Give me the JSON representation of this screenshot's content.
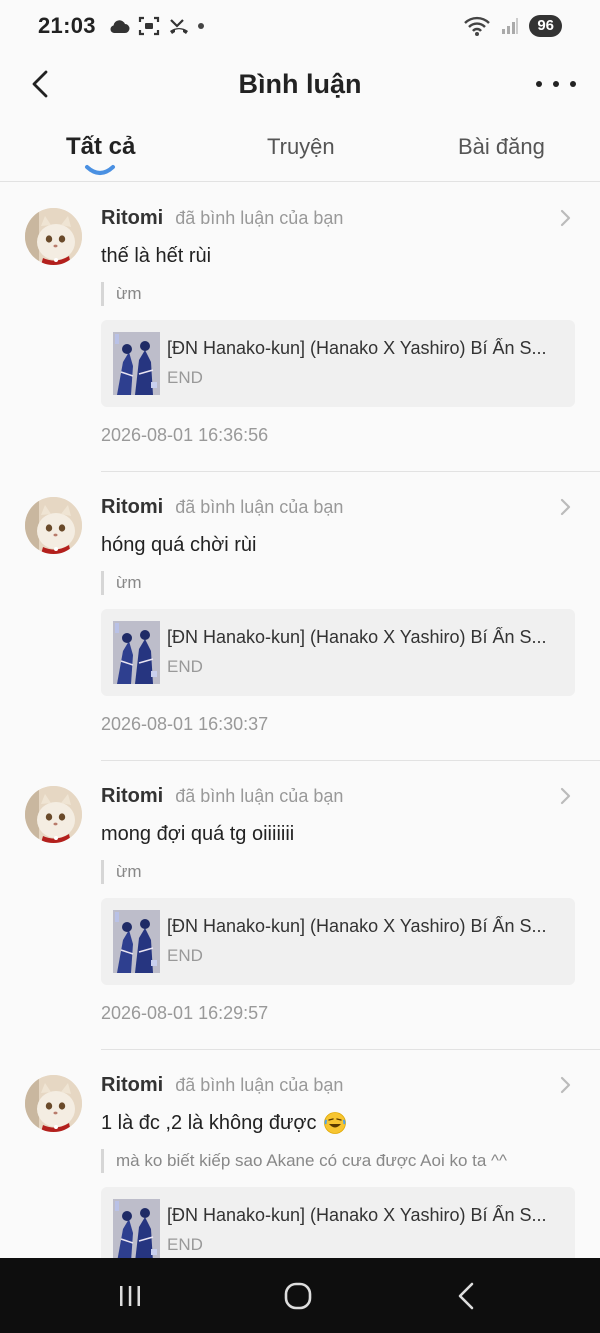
{
  "status_bar": {
    "time": "21:03",
    "battery": "96"
  },
  "header": {
    "title": "Bình luận"
  },
  "tabs": [
    {
      "label": "Tất cả",
      "active": true
    },
    {
      "label": "Truyện",
      "active": false
    },
    {
      "label": "Bài đăng",
      "active": false
    }
  ],
  "comments": [
    {
      "user": "Ritomi",
      "action": "đã bình luận của bạn",
      "text": "thế là hết rùi",
      "quote": "ừm",
      "story_title": "[ĐN Hanako-kun] (Hanako X Yashiro) Bí Ẩn S...",
      "story_status": "END",
      "timestamp": "2026-08-01 16:36:56"
    },
    {
      "user": "Ritomi",
      "action": "đã bình luận của bạn",
      "text": "hóng quá chời rùi",
      "quote": "ừm",
      "story_title": "[ĐN Hanako-kun] (Hanako X Yashiro) Bí Ẩn S...",
      "story_status": "END",
      "timestamp": "2026-08-01 16:30:37"
    },
    {
      "user": "Ritomi",
      "action": "đã bình luận của bạn",
      "text": "mong đợi quá tg oiiiiiii",
      "quote": "ừm",
      "story_title": "[ĐN Hanako-kun] (Hanako X Yashiro) Bí Ẩn S...",
      "story_status": "END",
      "timestamp": "2026-08-01 16:29:57"
    },
    {
      "user": "Ritomi",
      "action": "đã bình luận của bạn",
      "text": "1 là đc ,2 là không được",
      "emoji": "rofl-emoji",
      "quote": "mà ko biết kiếp sao Akane có cưa được Aoi ko ta ^^",
      "story_title": "[ĐN Hanako-kun] (Hanako X Yashiro) Bí Ẩn S...",
      "story_status": "END",
      "timestamp": ""
    }
  ],
  "icons": {
    "back": "chevron-left-icon",
    "more": "more-horizontal-icon",
    "item_arrow": "chevron-right-icon",
    "nav_recents": "recents-icon",
    "nav_home": "home-icon",
    "nav_back": "back-icon"
  },
  "colors": {
    "accent": "#4a90e2",
    "background": "#fafafa",
    "card": "#f0f0f0",
    "navbar": "#0e0e0e"
  }
}
